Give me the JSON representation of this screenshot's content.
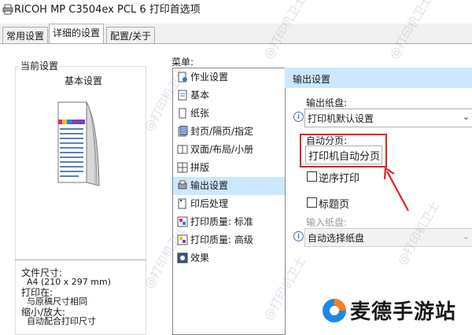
{
  "window": {
    "title": "RICOH MP C3504ex PCL 6 打印首选项"
  },
  "tabs": [
    {
      "label": "常用设置"
    },
    {
      "label": "详细的设置"
    },
    {
      "label": "配置/关于"
    }
  ],
  "left_panel": {
    "group_title": "当前设置",
    "preview_title": "基本设置",
    "paper_size_label": "文件尺寸:",
    "paper_size_value": "A4 (210 x 297 mm)",
    "print_on_label": "打印在:",
    "print_on_value": "与原稿尺寸相同",
    "zoom_label": "缩小/放大:",
    "zoom_value": "自动配合打印尺寸"
  },
  "menu": {
    "label": "菜单:",
    "items": [
      {
        "label": "作业设置",
        "icon": "job-settings-icon"
      },
      {
        "label": "基本",
        "icon": "basic-icon"
      },
      {
        "label": "纸张",
        "icon": "paper-icon"
      },
      {
        "label": "封页/隔页/指定",
        "icon": "cover-icon"
      },
      {
        "label": "双面/布局/小册",
        "icon": "duplex-icon"
      },
      {
        "label": "拼版",
        "icon": "imposition-icon"
      },
      {
        "label": "输出设置",
        "icon": "output-icon"
      },
      {
        "label": "印后处理",
        "icon": "finishing-icon"
      },
      {
        "label": "打印质量: 标准",
        "icon": "quality-standard-icon"
      },
      {
        "label": "打印质量: 高级",
        "icon": "quality-advanced-icon"
      },
      {
        "label": "效果",
        "icon": "effects-icon"
      }
    ],
    "selected": "输出设置"
  },
  "output_settings": {
    "header": "输出设置",
    "output_tray_label": "输出纸盘:",
    "output_tray_value": "打印机默认设置",
    "auto_sort_label": "自动分页:",
    "auto_sort_value": "打印机自动分页",
    "reverse_order_label": "逆序打印",
    "reverse_order_checked": false,
    "slip_sheet_label": "标题页",
    "slip_sheet_checked": false,
    "input_tray_label": "输入纸盘:",
    "input_tray_value": "自动选择纸盘"
  },
  "watermark": {
    "text": "@打印机卫士"
  },
  "brand": {
    "text": "麦德手游站"
  },
  "colors": {
    "selected_bg": "#cce8ff",
    "annotation_red": "#e02020",
    "brand_orange": "#f58220",
    "brand_blue": "#1e88e5"
  }
}
